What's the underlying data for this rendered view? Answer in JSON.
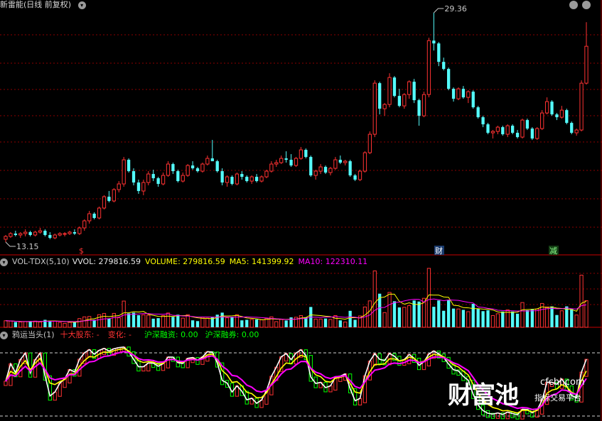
{
  "header": {
    "title": "新雷能(日线 前复权)"
  },
  "price_panel": {
    "high_label": "29.36",
    "low_label": "13.15",
    "event_markers": [
      "$",
      "财",
      "减"
    ]
  },
  "volume_panel": {
    "indicator": "VOL-TDX(5,10)",
    "vvol": "VVOL: 279816.59",
    "volume": "VOLUME: 279816.59",
    "ma5": "MA5: 141399.92",
    "ma10": "MA10: 122310.11"
  },
  "indicator_panel": {
    "name": "鸦运当头(1)",
    "item1": "十大股东: -",
    "item2": "变化: -",
    "item3": "沪深融资: 0.00",
    "item4": "沪深融券: 0.00"
  },
  "watermark": {
    "brand": "财富池",
    "domain": "cfchi.com",
    "tagline": "指标交易平台"
  },
  "colors": {
    "up": "#ff3232",
    "down": "#54fcfc",
    "grid": "#8b0000",
    "ma5": "#ffff00",
    "ma10": "#ff00ff",
    "white_line": "#ffffff",
    "green_step": "#00ff00"
  },
  "chart_data": {
    "type": "candlestick",
    "title": "新雷能(日线 前复权)",
    "price_high": 29.36,
    "price_low": 13.15,
    "candles": [
      [
        13.4,
        13.7,
        13.2,
        13.6
      ],
      [
        13.6,
        13.9,
        13.5,
        13.8
      ],
      [
        13.8,
        14.0,
        13.6,
        13.7
      ],
      [
        13.7,
        13.9,
        13.5,
        13.8
      ],
      [
        13.8,
        14.1,
        13.6,
        13.9
      ],
      [
        13.9,
        14.0,
        13.6,
        13.7
      ],
      [
        13.7,
        14.0,
        13.6,
        13.9
      ],
      [
        13.9,
        14.2,
        13.8,
        14.0
      ],
      [
        14.0,
        14.1,
        13.6,
        13.7
      ],
      [
        13.7,
        13.9,
        13.4,
        13.5
      ],
      [
        13.5,
        13.8,
        13.4,
        13.7
      ],
      [
        13.7,
        13.9,
        13.6,
        13.8
      ],
      [
        13.8,
        13.9,
        13.6,
        13.8
      ],
      [
        13.8,
        14.0,
        13.7,
        13.9
      ],
      [
        13.9,
        14.1,
        13.7,
        13.8
      ],
      [
        13.8,
        14.3,
        13.7,
        14.2
      ],
      [
        14.2,
        14.8,
        14.0,
        14.7
      ],
      [
        14.7,
        15.4,
        14.5,
        15.2
      ],
      [
        15.2,
        15.3,
        14.8,
        14.9
      ],
      [
        14.9,
        15.7,
        14.8,
        15.6
      ],
      [
        15.6,
        16.5,
        15.5,
        16.4
      ],
      [
        16.4,
        16.8,
        16.0,
        16.1
      ],
      [
        16.1,
        17.0,
        16.0,
        16.9
      ],
      [
        16.9,
        17.5,
        16.7,
        17.3
      ],
      [
        17.3,
        19.2,
        17.1,
        19.0
      ],
      [
        19.0,
        19.1,
        18.1,
        18.2
      ],
      [
        18.2,
        18.4,
        17.2,
        17.4
      ],
      [
        17.4,
        17.6,
        16.6,
        16.8
      ],
      [
        16.8,
        17.6,
        16.5,
        17.4
      ],
      [
        17.4,
        18.2,
        17.2,
        18.0
      ],
      [
        18.0,
        18.3,
        17.5,
        17.7
      ],
      [
        17.7,
        17.8,
        17.1,
        17.3
      ],
      [
        17.3,
        18.1,
        17.2,
        17.9
      ],
      [
        17.9,
        18.9,
        17.8,
        18.7
      ],
      [
        18.7,
        18.8,
        18.0,
        18.2
      ],
      [
        18.2,
        18.3,
        17.4,
        17.5
      ],
      [
        17.5,
        18.1,
        17.4,
        17.9
      ],
      [
        17.9,
        18.7,
        17.8,
        18.6
      ],
      [
        18.6,
        18.9,
        18.3,
        18.4
      ],
      [
        18.4,
        18.5,
        18.1,
        18.2
      ],
      [
        18.2,
        18.8,
        18.1,
        18.7
      ],
      [
        18.7,
        19.3,
        18.6,
        19.1
      ],
      [
        19.1,
        20.4,
        18.9,
        18.9
      ],
      [
        18.9,
        19.0,
        18.1,
        18.2
      ],
      [
        18.2,
        18.4,
        17.2,
        17.4
      ],
      [
        17.4,
        17.9,
        17.1,
        17.8
      ],
      [
        17.8,
        17.9,
        17.2,
        17.3
      ],
      [
        17.3,
        18.1,
        17.2,
        18.0
      ],
      [
        18.0,
        18.2,
        17.6,
        17.8
      ],
      [
        17.8,
        17.9,
        17.4,
        17.5
      ],
      [
        17.5,
        17.9,
        17.3,
        17.8
      ],
      [
        17.8,
        18.0,
        17.4,
        17.5
      ],
      [
        17.5,
        17.9,
        17.4,
        17.8
      ],
      [
        17.8,
        18.3,
        17.7,
        18.2
      ],
      [
        18.2,
        18.9,
        18.1,
        18.7
      ],
      [
        18.7,
        19.0,
        18.5,
        18.8
      ],
      [
        18.8,
        19.3,
        18.7,
        19.1
      ],
      [
        19.1,
        19.6,
        18.8,
        19.0
      ],
      [
        19.0,
        19.4,
        18.5,
        18.6
      ],
      [
        18.6,
        19.2,
        18.5,
        19.1
      ],
      [
        19.1,
        19.9,
        19.0,
        19.7
      ],
      [
        19.7,
        19.8,
        19.1,
        19.2
      ],
      [
        19.2,
        19.3,
        17.8,
        17.9
      ],
      [
        17.9,
        18.3,
        17.6,
        18.2
      ],
      [
        18.2,
        18.7,
        18.0,
        18.5
      ],
      [
        18.5,
        18.6,
        18.0,
        18.1
      ],
      [
        18.1,
        18.5,
        17.9,
        18.4
      ],
      [
        18.4,
        19.2,
        18.3,
        19.0
      ],
      [
        19.0,
        19.3,
        18.7,
        18.8
      ],
      [
        18.8,
        19.0,
        18.6,
        18.9
      ],
      [
        18.9,
        19.0,
        17.8,
        17.9
      ],
      [
        17.9,
        18.0,
        17.5,
        17.6
      ],
      [
        17.6,
        18.3,
        17.5,
        18.2
      ],
      [
        18.2,
        19.6,
        18.1,
        19.5
      ],
      [
        19.5,
        21.0,
        19.4,
        20.8
      ],
      [
        20.8,
        24.6,
        20.6,
        24.4
      ],
      [
        24.4,
        24.5,
        22.2,
        22.6
      ],
      [
        22.6,
        23.0,
        22.1,
        22.9
      ],
      [
        22.9,
        25.1,
        22.7,
        24.8
      ],
      [
        24.8,
        24.9,
        23.4,
        23.5
      ],
      [
        23.5,
        24.0,
        22.7,
        22.8
      ],
      [
        22.8,
        23.7,
        22.6,
        23.6
      ],
      [
        23.6,
        24.6,
        23.3,
        24.5
      ],
      [
        24.5,
        24.7,
        23.0,
        23.2
      ],
      [
        23.2,
        23.3,
        21.4,
        22.1
      ],
      [
        22.1,
        23.8,
        22.0,
        23.6
      ],
      [
        23.6,
        27.6,
        23.4,
        27.4
      ],
      [
        27.4,
        29.36,
        26.7,
        27.2
      ],
      [
        27.2,
        27.3,
        25.6,
        25.9
      ],
      [
        25.9,
        26.2,
        25.3,
        25.4
      ],
      [
        25.4,
        25.5,
        23.9,
        24.0
      ],
      [
        24.0,
        24.1,
        23.1,
        23.3
      ],
      [
        23.3,
        24.1,
        23.2,
        24.0
      ],
      [
        24.0,
        24.2,
        23.3,
        23.4
      ],
      [
        23.4,
        23.9,
        23.0,
        23.8
      ],
      [
        23.8,
        23.9,
        22.6,
        22.7
      ],
      [
        22.7,
        22.8,
        21.9,
        22.0
      ],
      [
        22.0,
        22.1,
        21.3,
        21.5
      ],
      [
        21.5,
        21.6,
        20.8,
        20.9
      ],
      [
        20.9,
        21.1,
        20.5,
        21.0
      ],
      [
        21.0,
        21.4,
        20.8,
        21.3
      ],
      [
        21.3,
        21.4,
        20.7,
        20.8
      ],
      [
        20.8,
        21.5,
        20.6,
        21.4
      ],
      [
        21.4,
        21.5,
        20.8,
        20.9
      ],
      [
        20.9,
        21.1,
        20.5,
        20.6
      ],
      [
        20.6,
        21.9,
        20.5,
        21.8
      ],
      [
        21.8,
        21.9,
        21.1,
        21.2
      ],
      [
        21.2,
        21.3,
        20.4,
        20.5
      ],
      [
        20.5,
        21.3,
        20.4,
        21.2
      ],
      [
        21.2,
        22.5,
        21.1,
        22.3
      ],
      [
        22.3,
        23.4,
        22.2,
        23.1
      ],
      [
        23.1,
        23.2,
        22.1,
        22.2
      ],
      [
        22.2,
        22.3,
        21.8,
        22.0
      ],
      [
        22.0,
        22.8,
        21.9,
        22.5
      ],
      [
        22.5,
        22.6,
        21.5,
        21.6
      ],
      [
        21.6,
        21.7,
        20.8,
        20.9
      ],
      [
        20.9,
        21.2,
        20.7,
        21.1
      ],
      [
        21.1,
        24.6,
        21.0,
        24.4
      ],
      [
        24.4,
        28.7,
        24.3,
        27.0
      ]
    ],
    "volume_labels": {
      "vvol": 279816.59,
      "volume": 279816.59,
      "ma5": 141399.92,
      "ma10": 122310.11
    }
  }
}
